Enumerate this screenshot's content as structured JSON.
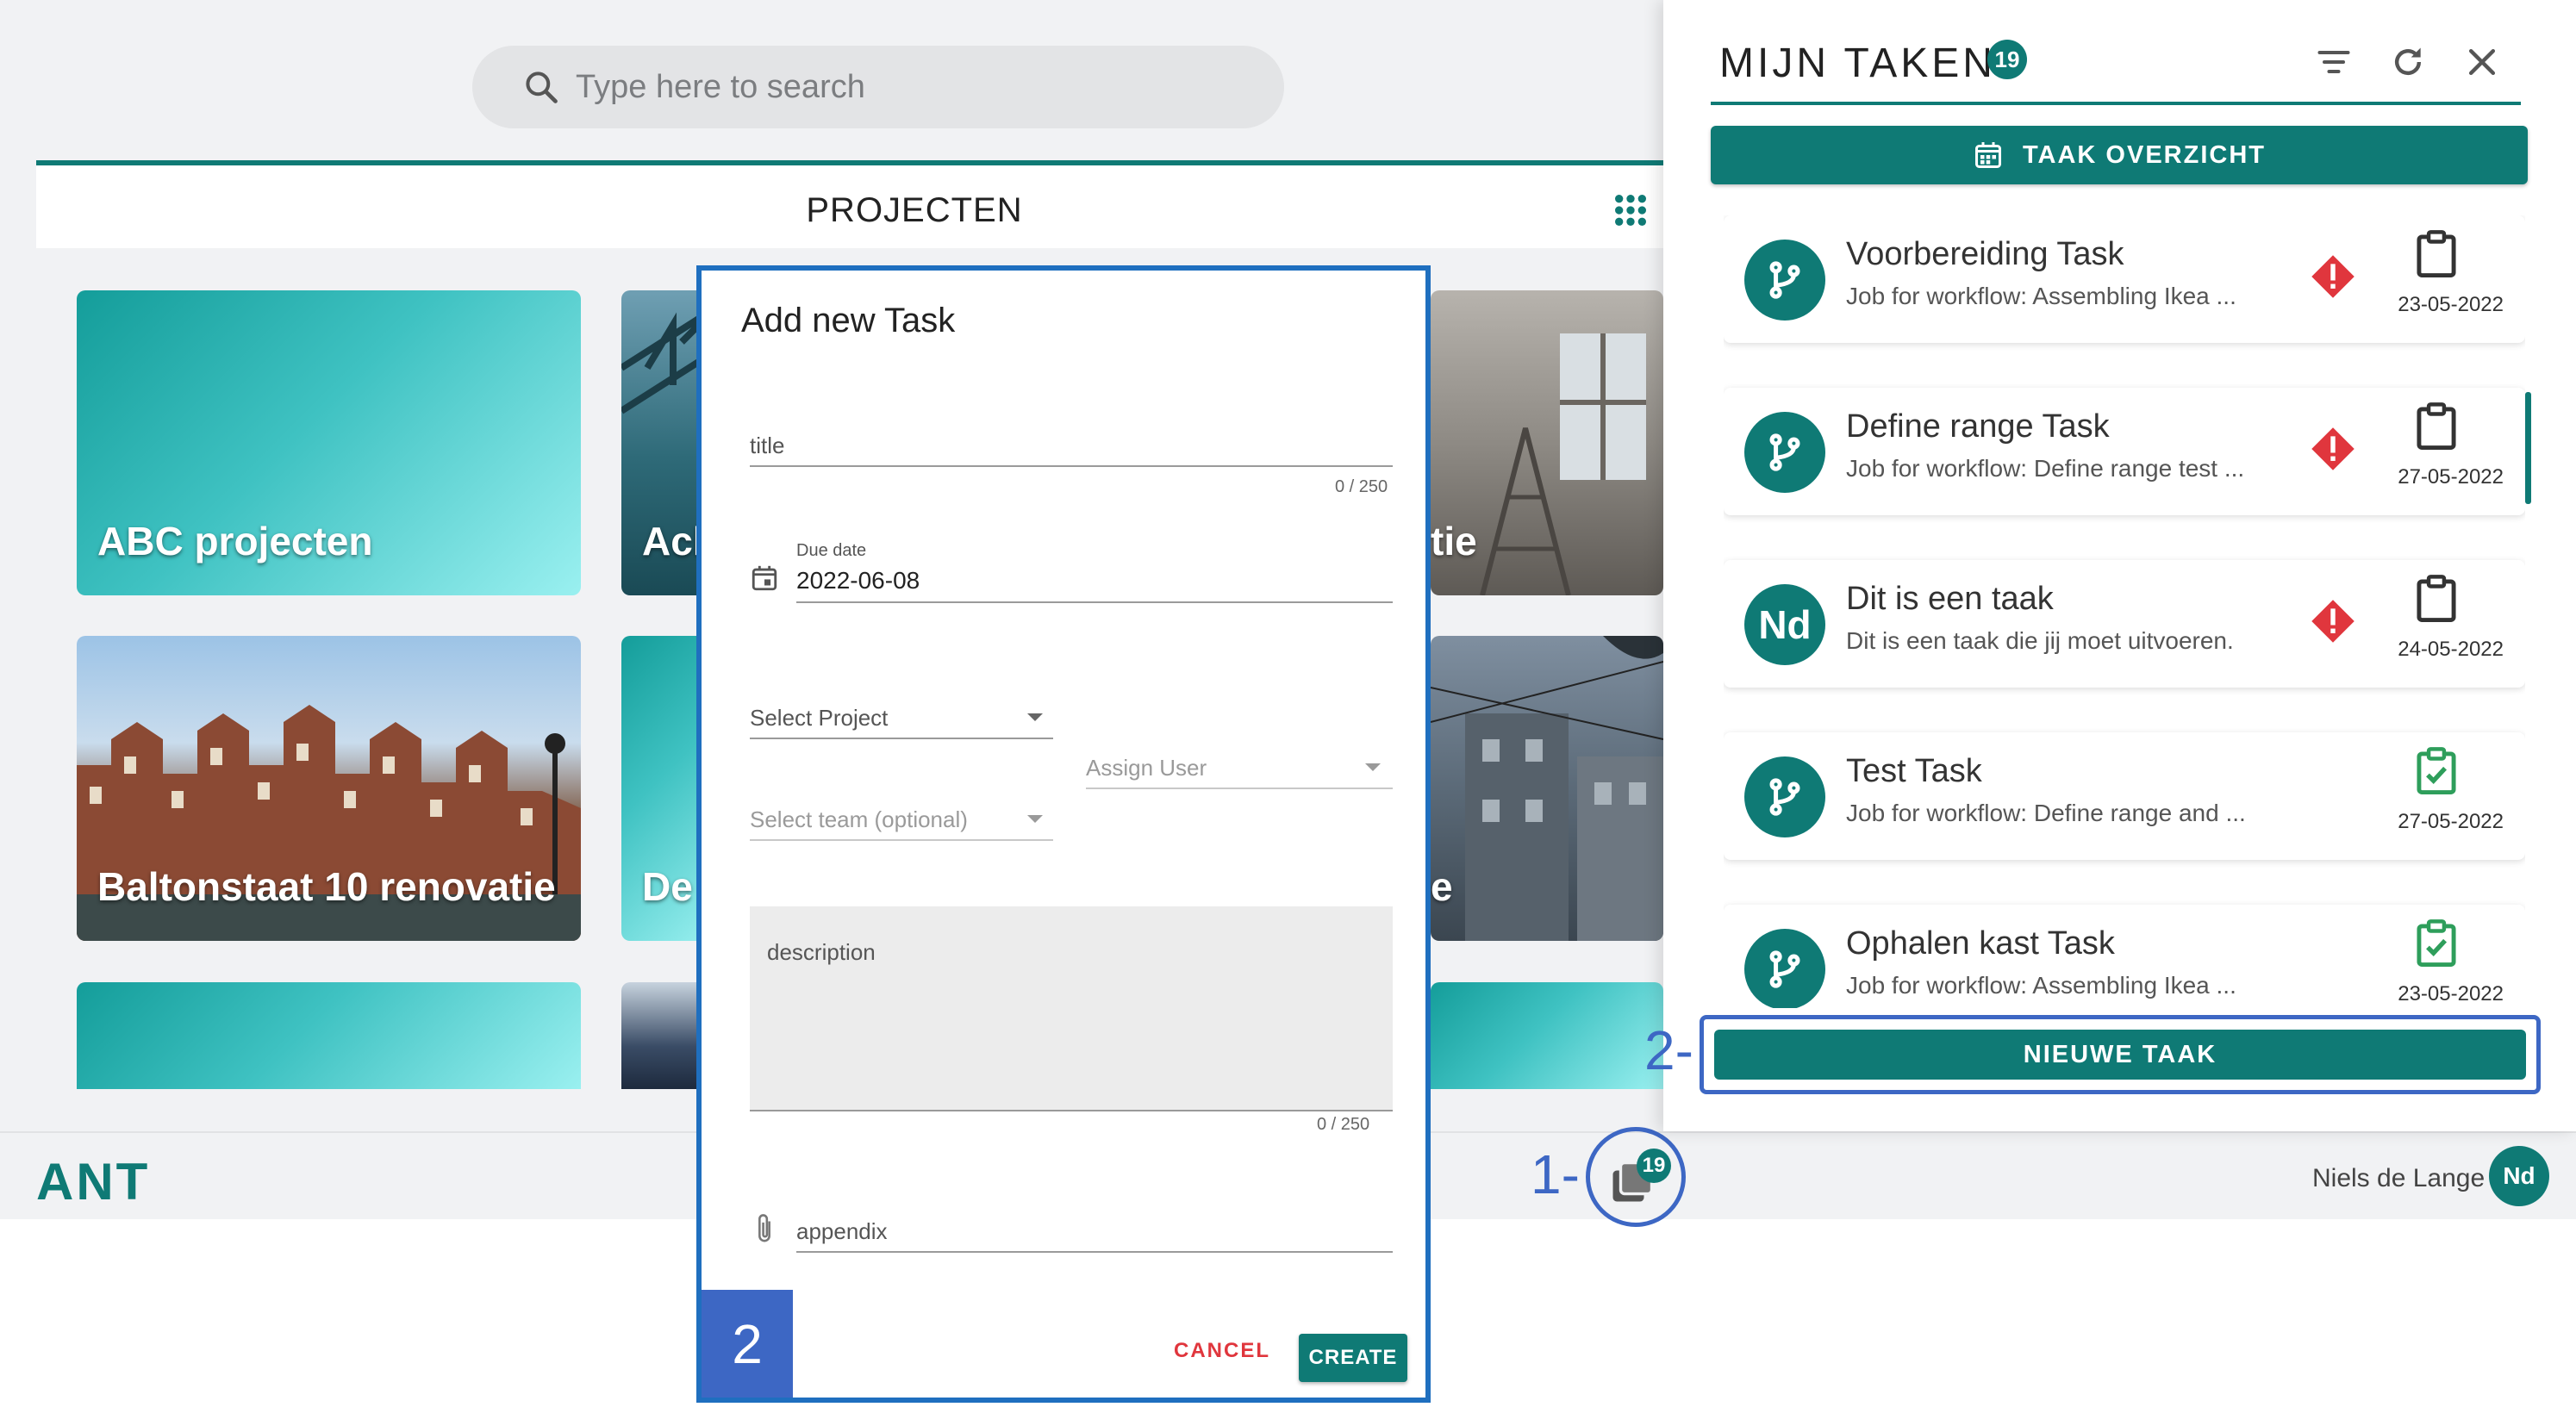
{
  "search": {
    "placeholder": "Type here to search"
  },
  "projects": {
    "title": "PROJECTEN",
    "tiles": [
      {
        "label": "ABC projecten"
      },
      {
        "label": "Acl"
      },
      {
        "label": "tie"
      },
      {
        "label": "Baltonstaat 10 renovatie"
      },
      {
        "label": "De"
      },
      {
        "label": "e"
      }
    ]
  },
  "footer": {
    "logo": "ANT",
    "user_name": "Niels de Lange",
    "user_initials": "Nd",
    "task_count": "19"
  },
  "callouts": {
    "one": "1",
    "two": "2",
    "two_dash": "2-",
    "one_dash": "1-"
  },
  "panel": {
    "title": "MIJN TAKEN",
    "count": "19",
    "overview_label": "TAAK OVERZICHT",
    "new_task_label": "NIEUWE TAAK",
    "tasks": [
      {
        "title": "Voorbereiding Task",
        "subtitle": "Job for workflow: Assembling Ikea ...",
        "date": "23-05-2022",
        "avatar": "workflow-icon",
        "status": "warning",
        "clipboard": "clipboard-icon"
      },
      {
        "title": "Define range Task",
        "subtitle": "Job for workflow: Define range test ...",
        "date": "27-05-2022",
        "avatar": "workflow-icon",
        "status": "warning",
        "clipboard": "clipboard-icon"
      },
      {
        "title": "Dit is een taak",
        "subtitle": "Dit is een taak die jij moet uitvoeren.",
        "date": "24-05-2022",
        "avatar_text": "Nd",
        "status": "warning",
        "clipboard": "clipboard-icon"
      },
      {
        "title": "Test Task",
        "subtitle": "Job for workflow: Define range and ...",
        "date": "27-05-2022",
        "avatar": "workflow-icon",
        "status": "done",
        "clipboard": "clipboard-check-icon"
      },
      {
        "title": "Ophalen kast Task",
        "subtitle": "Job for workflow: Assembling Ikea ...",
        "date": "23-05-2022",
        "avatar": "workflow-icon",
        "status": "done",
        "clipboard": "clipboard-check-icon"
      }
    ]
  },
  "dialog": {
    "title": "Add new Task",
    "title_field": {
      "label": "title",
      "counter": "0 / 250"
    },
    "due_date": {
      "label": "Due date",
      "value": "2022-06-08"
    },
    "select_project": "Select Project",
    "assign_user": "Assign User",
    "select_team": "Select team (optional)",
    "description": {
      "label": "description",
      "counter": "0 / 250"
    },
    "appendix": "appendix",
    "cancel_label": "CANCEL",
    "create_label": "CREATE",
    "step_number": "2"
  },
  "colors": {
    "brand": "#0f7a75",
    "callout": "#3d67c4",
    "warning": "#e0363d",
    "done": "#2e9e5b"
  }
}
